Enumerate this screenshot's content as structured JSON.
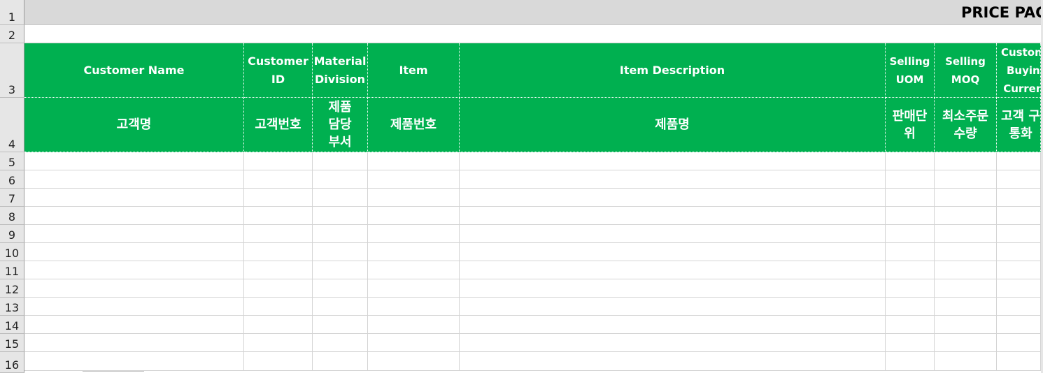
{
  "title": "PRICE PAGE -",
  "row_numbers": [
    "1",
    "2",
    "3",
    "4",
    "5",
    "6",
    "7",
    "8",
    "9",
    "10",
    "11",
    "12",
    "13",
    "14",
    "15",
    "16"
  ],
  "columns": [
    {
      "en": "Customer Name",
      "ko": "고객명"
    },
    {
      "en": "Customer\nID",
      "ko": "고객번호"
    },
    {
      "en": "Material\nDivision",
      "ko": "제품\n담당\n부서"
    },
    {
      "en": "Item",
      "ko": "제품번호"
    },
    {
      "en": "Item Description",
      "ko": "제품명"
    },
    {
      "en": "Selling\nUOM",
      "ko": "판매단\n위"
    },
    {
      "en": "Selling\nMOQ",
      "ko": "최소주문\n수량"
    },
    {
      "en": "Custom\nBuyin\nCurren",
      "ko": "고객 구\n통화"
    }
  ],
  "colors": {
    "header_green": "#00b050",
    "header_text": "#ffffff",
    "title_bg": "#d9d9d9",
    "row_header_bg": "#e6e6e6"
  }
}
